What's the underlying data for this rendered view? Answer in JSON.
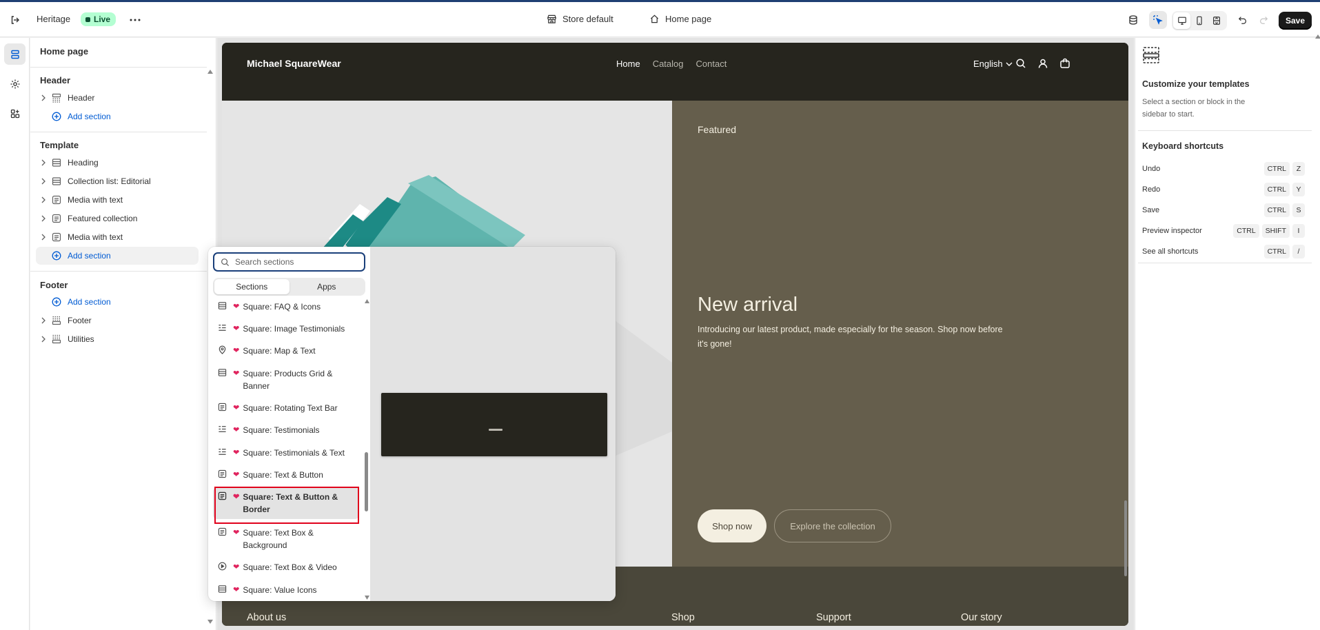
{
  "topbar": {
    "theme_name": "Heritage",
    "status_badge": "Live",
    "store_selector": "Store default",
    "page_selector": "Home page",
    "save_label": "Save"
  },
  "sidebar": {
    "title": "Home page",
    "header_group": "Header",
    "header_items": [
      {
        "label": "Header"
      }
    ],
    "add_section": "Add section",
    "template_group": "Template",
    "template_items": [
      {
        "label": "Heading"
      },
      {
        "label": "Collection list: Editorial"
      },
      {
        "label": "Media with text"
      },
      {
        "label": "Featured collection"
      },
      {
        "label": "Media with text"
      }
    ],
    "footer_group": "Footer",
    "footer_items": [
      {
        "label": "Footer"
      },
      {
        "label": "Utilities"
      }
    ]
  },
  "preview": {
    "brand": "Michael SquareWear",
    "nav": [
      "Home",
      "Catalog",
      "Contact"
    ],
    "language": "English",
    "featured_label": "Featured",
    "hero_title": "New arrival",
    "hero_text": "Introducing our latest product, made especially for the season. Shop now before it's gone!",
    "primary_button": "Shop now",
    "secondary_button": "Explore the collection",
    "footer_headings": [
      "About us",
      "Shop",
      "Support",
      "Our story"
    ]
  },
  "picker": {
    "search_placeholder": "Search sections",
    "tabs": [
      "Sections",
      "Apps"
    ],
    "items": [
      {
        "label": "Square: FAQ & Icons",
        "icon": "grid-icon"
      },
      {
        "label": "Square: Image Testimonials",
        "icon": "list-icon"
      },
      {
        "label": "Square: Map & Text",
        "icon": "map-pin-icon"
      },
      {
        "label": "Square: Products Grid & Banner",
        "icon": "grid-icon"
      },
      {
        "label": "Square: Rotating Text Bar",
        "icon": "text-icon"
      },
      {
        "label": "Square: Testimonials",
        "icon": "list-icon"
      },
      {
        "label": "Square: Testimonials & Text",
        "icon": "list-icon"
      },
      {
        "label": "Square: Text & Button",
        "icon": "text-icon"
      },
      {
        "label": "Square: Text & Button & Border",
        "icon": "text-icon"
      },
      {
        "label": "Square: Text Box & Background",
        "icon": "text-icon"
      },
      {
        "label": "Square: Text Box & Video",
        "icon": "play-icon"
      },
      {
        "label": "Square: Value Icons",
        "icon": "grid-icon"
      }
    ],
    "selected_index": 8
  },
  "right_panel": {
    "title": "Customize your templates",
    "subtitle": "Select a section or block in the sidebar to start.",
    "shortcuts_title": "Keyboard shortcuts",
    "shortcuts": [
      {
        "label": "Undo",
        "keys": [
          "CTRL",
          "Z"
        ]
      },
      {
        "label": "Redo",
        "keys": [
          "CTRL",
          "Y"
        ]
      },
      {
        "label": "Save",
        "keys": [
          "CTRL",
          "S"
        ]
      },
      {
        "label": "Preview inspector",
        "keys": [
          "CTRL",
          "SHIFT",
          "I"
        ]
      },
      {
        "label": "See all shortcuts",
        "keys": [
          "CTRL",
          "/"
        ]
      }
    ]
  },
  "colors": {
    "accent_link": "#005bd3",
    "live_badge_bg": "#b4fed2",
    "selection_outline": "#e0001b",
    "store_dark": "#26251e",
    "hero_olive": "#655e4c"
  }
}
